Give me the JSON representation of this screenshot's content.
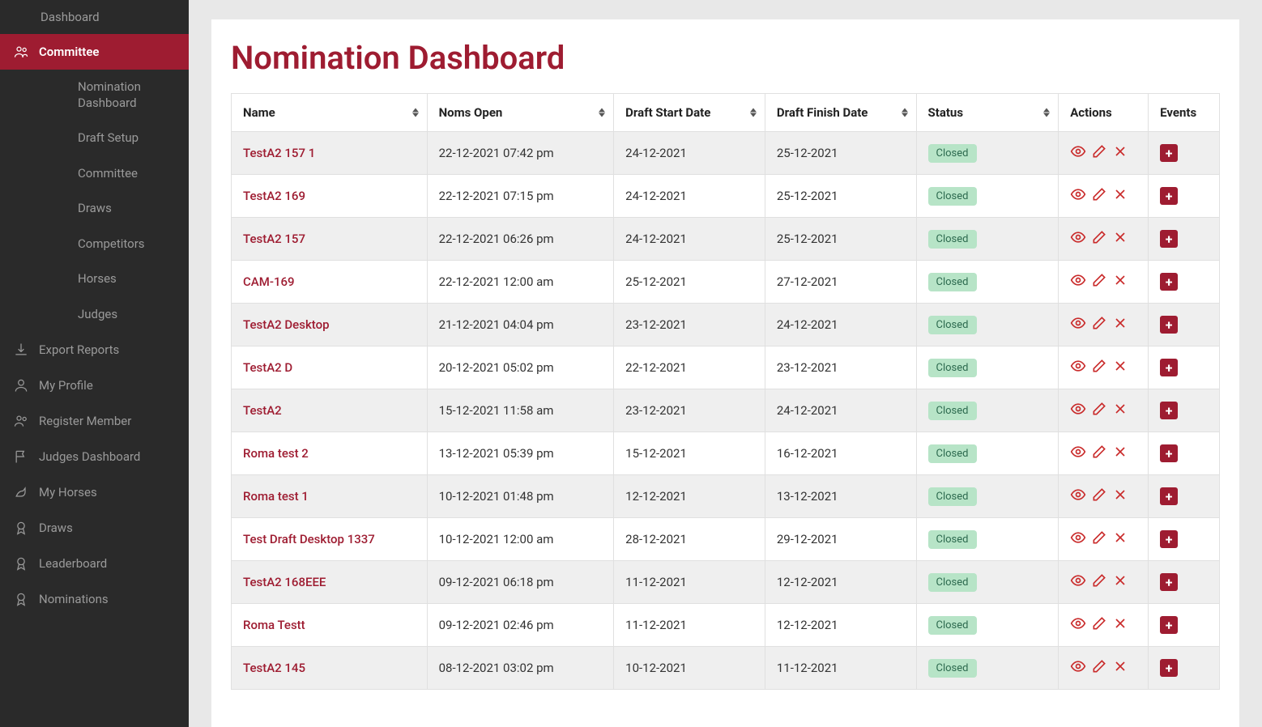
{
  "sidebar": {
    "top": "Dashboard",
    "active": "Committee",
    "sub": [
      "Nomination Dashboard",
      "Draft Setup",
      "Committee",
      "Draws",
      "Competitors",
      "Horses",
      "Judges"
    ],
    "items": [
      "Export Reports",
      "My Profile",
      "Register Member",
      "Judges Dashboard",
      "My Horses",
      "Draws",
      "Leaderboard",
      "Nominations"
    ]
  },
  "page": {
    "title": "Nomination Dashboard"
  },
  "table": {
    "headers": [
      "Name",
      "Noms Open",
      "Draft Start Date",
      "Draft Finish Date",
      "Status",
      "Actions",
      "Events"
    ],
    "rows": [
      {
        "name": "TestA2 157 1",
        "noms": "22-12-2021 07:42 pm",
        "start": "24-12-2021",
        "finish": "25-12-2021",
        "status": "Closed"
      },
      {
        "name": "TestA2 169",
        "noms": "22-12-2021 07:15 pm",
        "start": "24-12-2021",
        "finish": "25-12-2021",
        "status": "Closed"
      },
      {
        "name": "TestA2 157",
        "noms": "22-12-2021 06:26 pm",
        "start": "24-12-2021",
        "finish": "25-12-2021",
        "status": "Closed"
      },
      {
        "name": "CAM-169",
        "noms": "22-12-2021 12:00 am",
        "start": "25-12-2021",
        "finish": "27-12-2021",
        "status": "Closed"
      },
      {
        "name": "TestA2 Desktop",
        "noms": "21-12-2021 04:04 pm",
        "start": "23-12-2021",
        "finish": "24-12-2021",
        "status": "Closed"
      },
      {
        "name": "TestA2 D",
        "noms": "20-12-2021 05:02 pm",
        "start": "22-12-2021",
        "finish": "23-12-2021",
        "status": "Closed"
      },
      {
        "name": "TestA2",
        "noms": "15-12-2021 11:58 am",
        "start": "23-12-2021",
        "finish": "24-12-2021",
        "status": "Closed"
      },
      {
        "name": "Roma test 2",
        "noms": "13-12-2021 05:39 pm",
        "start": "15-12-2021",
        "finish": "16-12-2021",
        "status": "Closed"
      },
      {
        "name": "Roma test 1",
        "noms": "10-12-2021 01:48 pm",
        "start": "12-12-2021",
        "finish": "13-12-2021",
        "status": "Closed"
      },
      {
        "name": "Test Draft Desktop 1337",
        "noms": "10-12-2021 12:00 am",
        "start": "28-12-2021",
        "finish": "29-12-2021",
        "status": "Closed"
      },
      {
        "name": "TestA2 168EEE",
        "noms": "09-12-2021 06:18 pm",
        "start": "11-12-2021",
        "finish": "12-12-2021",
        "status": "Closed"
      },
      {
        "name": "Roma Testt",
        "noms": "09-12-2021 02:46 pm",
        "start": "11-12-2021",
        "finish": "12-12-2021",
        "status": "Closed"
      },
      {
        "name": "TestA2 145",
        "noms": "08-12-2021 03:02 pm",
        "start": "10-12-2021",
        "finish": "11-12-2021",
        "status": "Closed"
      }
    ]
  }
}
